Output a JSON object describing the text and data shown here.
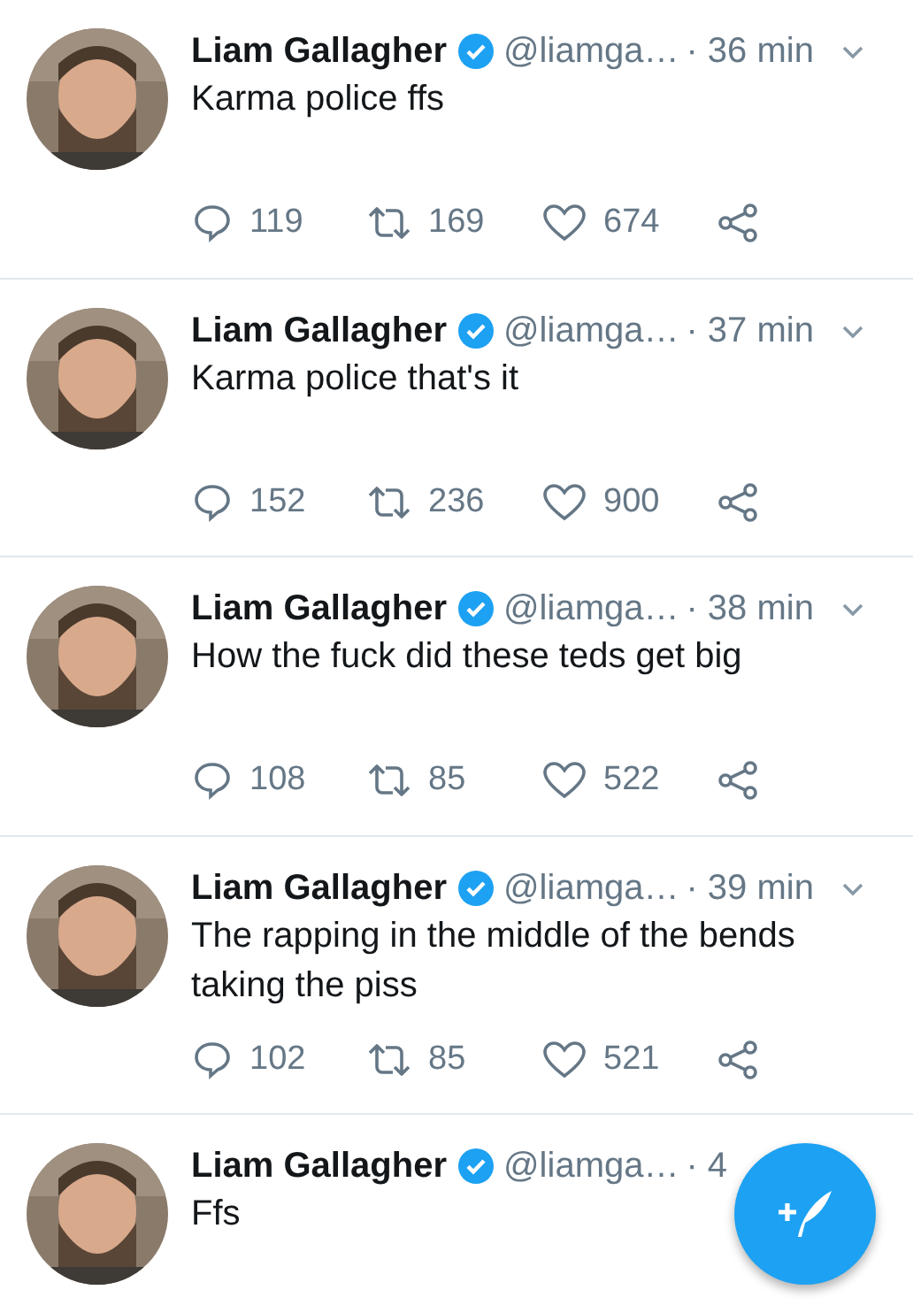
{
  "tweets": [
    {
      "name": "Liam Gallagher",
      "verified": true,
      "handle": "@liamga…",
      "time": "· 36 min",
      "text": "Karma police ffs",
      "replies": "119",
      "retweets": "169",
      "likes": "674"
    },
    {
      "name": "Liam Gallagher",
      "verified": true,
      "handle": "@liamga…",
      "time": "· 37 min",
      "text": "Karma police that's it",
      "replies": "152",
      "retweets": "236",
      "likes": "900"
    },
    {
      "name": "Liam Gallagher",
      "verified": true,
      "handle": "@liamga…",
      "time": "· 38 min",
      "text": "How the fuck did these teds get big",
      "replies": "108",
      "retweets": "85",
      "likes": "522"
    },
    {
      "name": "Liam Gallagher",
      "verified": true,
      "handle": "@liamga…",
      "time": "· 39 min",
      "text": "The rapping in the middle of the bends taking the piss",
      "replies": "102",
      "retweets": "85",
      "likes": "521"
    },
    {
      "name": "Liam Gallagher",
      "verified": true,
      "handle": "@liamga…",
      "time": "· 4",
      "text": "Ffs"
    }
  ]
}
